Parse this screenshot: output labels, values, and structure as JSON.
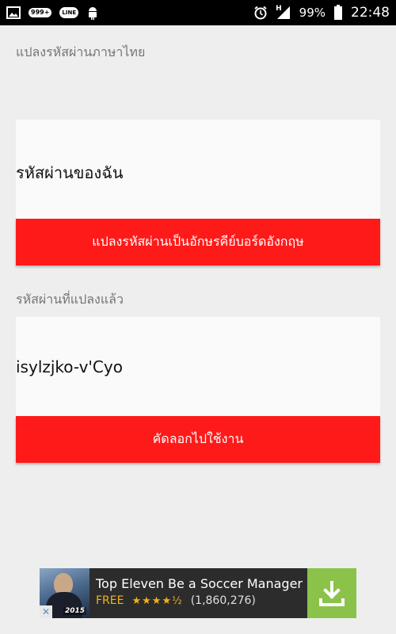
{
  "status_bar": {
    "notif_badge": "999+",
    "line_label": "LINE",
    "network_label": "H",
    "battery": "99%",
    "time": "22:48"
  },
  "converter": {
    "title": "แปลงรหัสผ่านภาษาไทย",
    "password_input_value": "รหัสผ่านของฉัน",
    "convert_button_label": "แปลงรหัสผ่านเป็นอักษรคีย์บอร์ดอังกฤษ",
    "result_label": "รหัสผ่านที่แปลงแล้ว",
    "result_value": "isylzjko-v'Cyo",
    "copy_button_label": "คัดลอกไปใช้งาน"
  },
  "ad": {
    "title": "Top Eleven Be a Soccer Manager",
    "price": "FREE",
    "rating": 4.5,
    "stars": "★★★★½",
    "review_count": "(1,860,276)",
    "thumb_year": "2015",
    "close_symbol": "✕",
    "accent_color": "#8bc34a"
  },
  "colors": {
    "button": "#ff1a1a",
    "background": "#eeeeee"
  }
}
